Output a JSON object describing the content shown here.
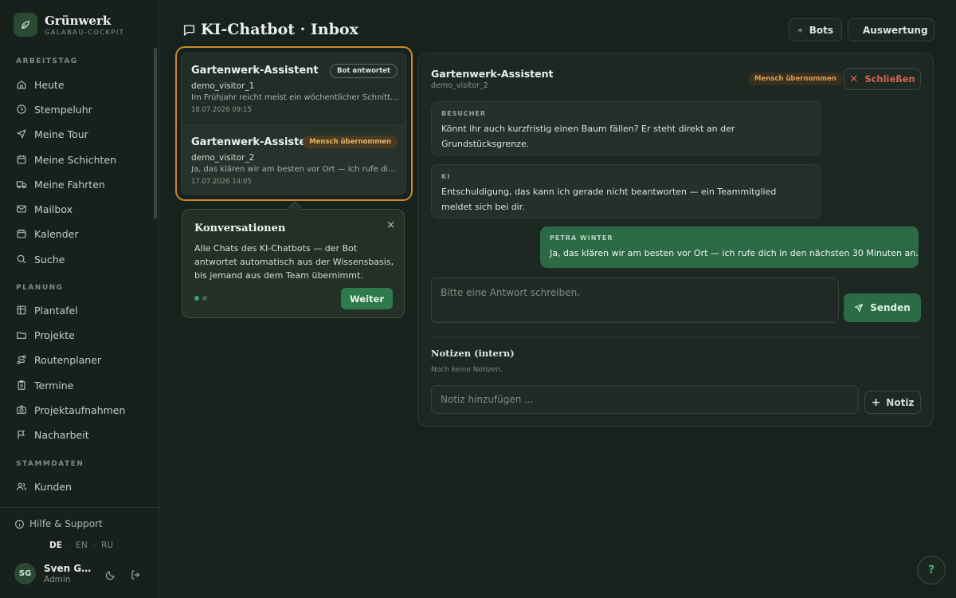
{
  "brand": {
    "name": "Grünwerk",
    "subtitle": "GALABAU-COCKPIT"
  },
  "sidebar": {
    "sections": [
      {
        "label": "ARBEITSTAG",
        "items": [
          {
            "label": "Heute",
            "icon": "home-icon"
          },
          {
            "label": "Stempeluhr",
            "icon": "clock-icon"
          },
          {
            "label": "Meine Tour",
            "icon": "navigation-icon"
          },
          {
            "label": "Meine Schichten",
            "icon": "calendar-icon"
          },
          {
            "label": "Meine Fahrten",
            "icon": "truck-icon"
          },
          {
            "label": "Mailbox",
            "icon": "mail-icon"
          },
          {
            "label": "Kalender",
            "icon": "calendar-icon"
          },
          {
            "label": "Suche",
            "icon": "search-icon"
          }
        ]
      },
      {
        "label": "PLANUNG",
        "items": [
          {
            "label": "Plantafel",
            "icon": "grid-icon"
          },
          {
            "label": "Projekte",
            "icon": "folder-icon"
          },
          {
            "label": "Routenplaner",
            "icon": "route-icon"
          },
          {
            "label": "Termine",
            "icon": "clipboard-icon"
          },
          {
            "label": "Projektaufnahmen",
            "icon": "camera-icon"
          },
          {
            "label": "Nacharbeit",
            "icon": "flag-icon"
          }
        ]
      },
      {
        "label": "STAMMDATEN",
        "items": [
          {
            "label": "Kunden",
            "icon": "users-icon"
          }
        ]
      }
    ],
    "help": "Hilfe & Support",
    "languages": [
      "DE",
      "EN",
      "RU"
    ],
    "active_language": "DE",
    "user": {
      "initials": "SG",
      "name": "Sven Ga...",
      "role": "Admin"
    }
  },
  "header": {
    "title": "KI-Chatbot · Inbox",
    "buttons": [
      {
        "label": "Bots",
        "icon": "gear-icon"
      },
      {
        "label": "Auswertung",
        "icon": "bar-chart-icon"
      }
    ]
  },
  "conversations": [
    {
      "name": "Gartenwerk-Assistent",
      "badge": "Bot antwortet",
      "visitor": "demo_visitor_1",
      "preview": "Im Frühjahr reicht meist ein wöchentlicher Schnitt, so...",
      "date": "18.07.2026 09:15"
    },
    {
      "name": "Gartenwerk-Assistent",
      "badge": "Mensch übernommen",
      "visitor": "demo_visitor_2",
      "preview": "Ja, das klären wir am besten vor Ort — ich rufe dich in...",
      "date": "17.07.2026 14:05"
    }
  ],
  "tour": {
    "title": "Konversationen",
    "text": "Alle Chats des KI-Chatbots — der Bot antwortet automatisch aus der Wissensbasis, bis jemand aus dem Team übernimmt.",
    "next": "Weiter",
    "close": "×",
    "step": 1,
    "total_steps": 2
  },
  "detail": {
    "title": "Gartenwerk-Assistent",
    "visitor": "demo_visitor_2",
    "badge": "Mensch übernommen",
    "close_label": "Schließen",
    "messages": [
      {
        "sender": "BESUCHER",
        "text": "Könnt ihr auch kurzfristig einen Baum fällen? Er steht direkt an der Grundstücksgrenze."
      },
      {
        "sender": "KI",
        "text": "Entschuldigung, das kann ich gerade nicht beantworten — ein Teammitglied meldet sich bei dir."
      },
      {
        "sender": "PETRA WINTER",
        "text": "Ja, das klären wir am besten vor Ort — ich rufe dich in den nächsten 30 Minuten an."
      }
    ],
    "reply_placeholder": "Bitte eine Antwort schreiben.",
    "send_label": "Senden",
    "notes_title": "Notizen (intern)",
    "notes_empty": "Noch keine Notizen.",
    "note_placeholder": "Notiz hinzufügen ...",
    "note_button": "Notiz"
  },
  "help_fab": "?",
  "colors": {
    "accent": "#2f7a4c",
    "highlight": "#c8892e",
    "danger": "#d66452",
    "warning": "#e8b368"
  }
}
